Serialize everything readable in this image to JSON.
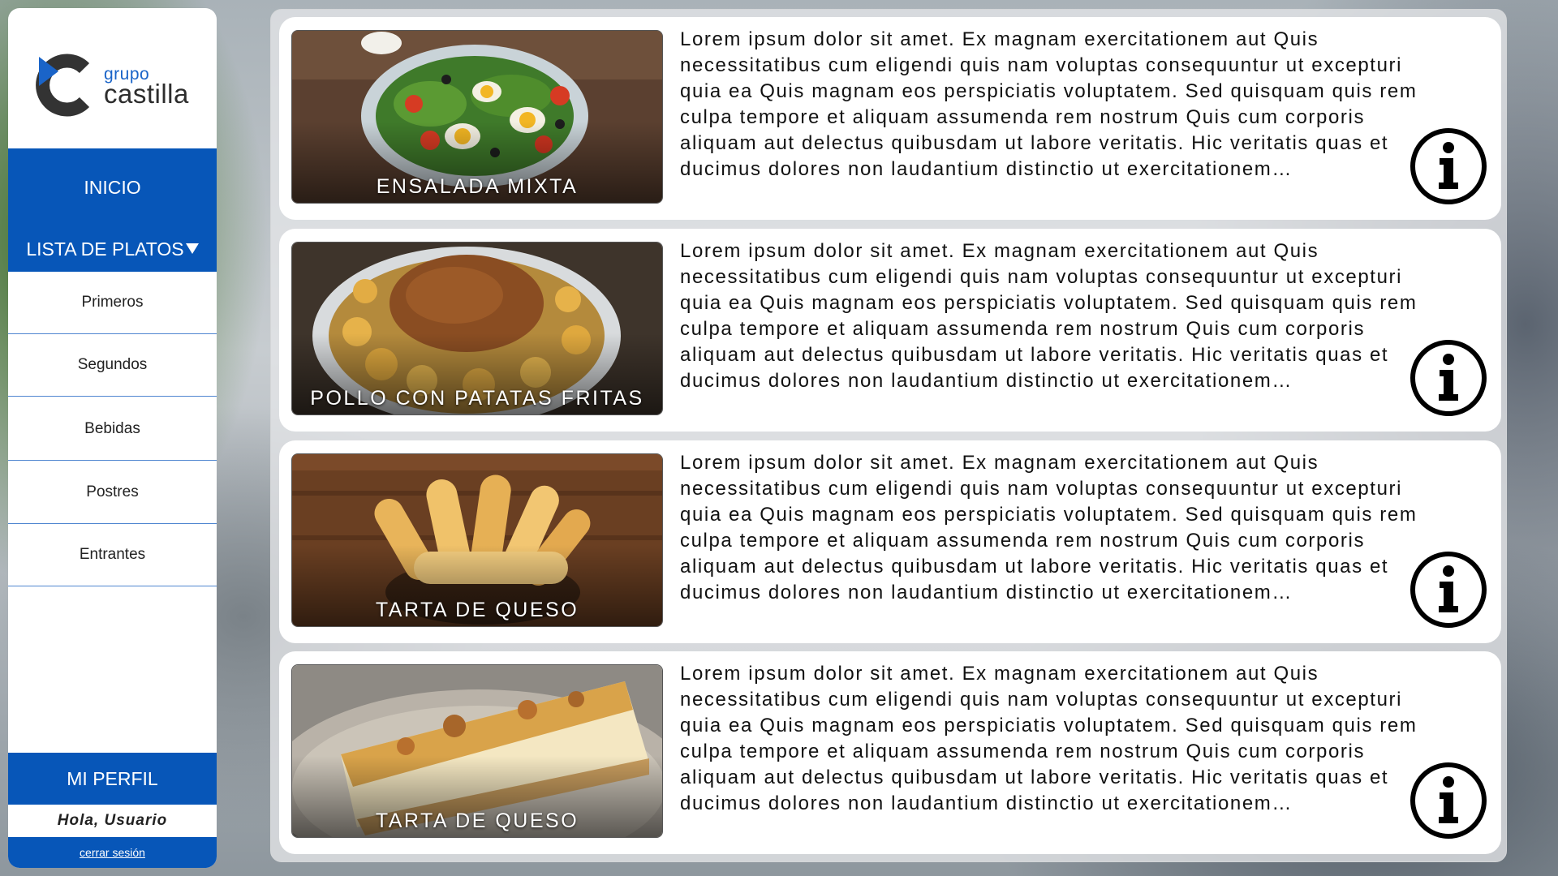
{
  "brand": {
    "line1": "grupo",
    "line2": "castilla",
    "accent": "#1a64c8",
    "dark": "#2d2d2d"
  },
  "colors": {
    "nav_blue": "#0756b8",
    "divider": "#4f86d0"
  },
  "nav": {
    "inicio": "INICIO",
    "lista": "LISTA DE PLATOS"
  },
  "submenu": [
    "Primeros",
    "Segundos",
    "Bebidas",
    "Postres",
    "Entrantes"
  ],
  "profile": {
    "button": "MI PERFIL",
    "greeting": "Hola, Usuario",
    "logout": "cerrar sesión"
  },
  "dishes": [
    {
      "title": "ENSALADA MIXTA",
      "photo": "salad-photo",
      "description": "Lorem ipsum dolor sit amet. Ex magnam exercitationem aut Quis necessitatibus cum eligendi quis nam voluptas consequuntur ut excepturi quia ea Quis magnam eos perspiciatis voluptatem. Sed quisquam quis rem culpa tempore et aliquam assumenda rem nostrum Quis cum corporis aliquam aut delectus quibusdam ut labore veritatis. Hic veritatis quas et ducimus dolores non laudantium distinctio ut exercitationem…"
    },
    {
      "title": "POLLO CON PATATAS FRITAS",
      "photo": "chicken-photo",
      "description": "Lorem ipsum dolor sit amet. Ex magnam exercitationem aut Quis necessitatibus cum eligendi quis nam voluptas consequuntur ut excepturi quia ea Quis magnam eos perspiciatis voluptatem. Sed quisquam quis rem culpa tempore et aliquam assumenda rem nostrum Quis cum corporis aliquam aut delectus quibusdam ut labore veritatis. Hic veritatis quas et ducimus dolores non laudantium distinctio ut exercitationem…"
    },
    {
      "title": "TARTA DE QUESO",
      "photo": "bread-rolls-photo",
      "description": "Lorem ipsum dolor sit amet. Ex magnam exercitationem aut Quis necessitatibus cum eligendi quis nam voluptas consequuntur ut excepturi quia ea Quis magnam eos perspiciatis voluptatem. Sed quisquam quis rem culpa tempore et aliquam assumenda rem nostrum Quis cum corporis aliquam aut delectus quibusdam ut labore veritatis. Hic veritatis quas et ducimus dolores non laudantium distinctio ut exercitationem…"
    },
    {
      "title": "TARTA DE QUESO",
      "photo": "cheesecake-photo",
      "description": "Lorem ipsum dolor sit amet. Ex magnam exercitationem aut Quis necessitatibus cum eligendi quis nam voluptas consequuntur ut excepturi quia ea Quis magnam eos perspiciatis voluptatem. Sed quisquam quis rem culpa tempore et aliquam assumenda rem nostrum Quis cum corporis aliquam aut delectus quibusdam ut labore veritatis. Hic veritatis quas et ducimus dolores non laudantium distinctio ut exercitationem…"
    }
  ]
}
